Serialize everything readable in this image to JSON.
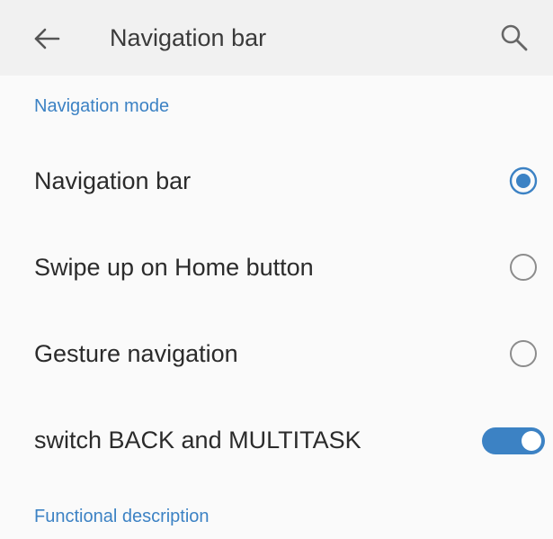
{
  "toolbar": {
    "title": "Navigation bar",
    "back_icon": "arrow-left-icon",
    "search_icon": "search-icon"
  },
  "sections": {
    "navigation_mode": "Navigation mode",
    "functional_description": "Functional description"
  },
  "options": [
    {
      "label": "Navigation bar",
      "selected": true
    },
    {
      "label": "Swipe up on Home button",
      "selected": false
    },
    {
      "label": "Gesture navigation",
      "selected": false
    }
  ],
  "switch_row": {
    "label": "switch BACK and MULTITASK",
    "enabled": true
  },
  "colors": {
    "accent": "#3c82c4",
    "toolbar_bg": "#f1f1f1",
    "page_bg": "#fafafa",
    "radio_off": "#8c8c8c"
  }
}
